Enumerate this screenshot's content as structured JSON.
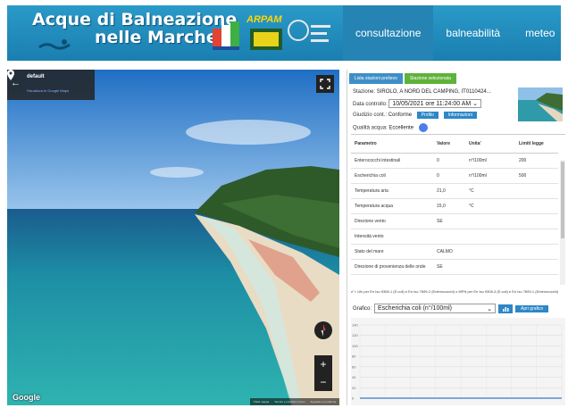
{
  "header": {
    "title_line1": "Acque di Balneazione",
    "title_line2": "nelle Marche",
    "arpam_logo_text": "ARPAM",
    "nav": [
      {
        "label": "consultazione analisi",
        "active": true
      },
      {
        "label": "balneabilità",
        "active": false
      },
      {
        "label": "meteo",
        "active": false
      }
    ],
    "colors": {
      "header_bg": "#1a7fb0",
      "nav_active": "#2584b4"
    }
  },
  "streetview": {
    "place_name": "default",
    "view_link": "Visualizza in Google Maps",
    "watermark": "Google",
    "zoom_in": "+",
    "zoom_out": "−",
    "back_arrow": "←",
    "footer_links": [
      "©Dati mappa",
      "Termini e condizioni d'uso",
      "Segnala un problema"
    ]
  },
  "panel": {
    "tabs": [
      "Lista stazioni prelievo",
      "Stazione selezionata"
    ],
    "station_label": "Stazione:",
    "station_value": "SIROLO, A NORD DEL CAMPING, IT0110424...",
    "date_label": "Data controllo:",
    "date_value": "10/05/2021 ore 11:24:00 AM",
    "judgement_label": "Giudizio cont.:",
    "judgement_value": "Conforme",
    "profile_button": "Profilo",
    "info_button": "Informazioni",
    "quality_label": "Qualità acqua:",
    "quality_value": "Eccellente",
    "table": {
      "headers": [
        "Parametro",
        "Valore",
        "Unita'",
        "Limiti legge"
      ],
      "rows": [
        [
          "Enterococchi intestinali",
          "0",
          "n°/100ml",
          "200"
        ],
        [
          "Escherichia coli",
          "0",
          "n°/100ml",
          "500"
        ],
        [
          "Temperatura aria",
          "21,0",
          "°C",
          ""
        ],
        [
          "Temperatura acqua",
          "15,0",
          "°C",
          ""
        ],
        [
          "Direzione vento",
          "SE",
          "",
          ""
        ],
        [
          "Intensità vento",
          "",
          "",
          ""
        ],
        [
          "Stato del mare",
          "CALMO",
          "",
          ""
        ],
        [
          "Direzione di provenienza delle onde",
          "SE",
          "",
          ""
        ]
      ]
    },
    "note": "n°= Ufc per En Iso 9308-1 (E.coli) e En Iso 7899-2 (Enterococchi) o MPN per En Iso 9308-3 (E.coli) e En Iso 7899-1 (Enterococchi)",
    "grafico_label": "Grafico:",
    "grafico_value": "Escherichia coli (n°/100ml)",
    "apri_button": "Apri grafico",
    "chart_ticks": [
      "140",
      "120",
      "100",
      "80",
      "60",
      "40",
      "20",
      "0"
    ]
  }
}
